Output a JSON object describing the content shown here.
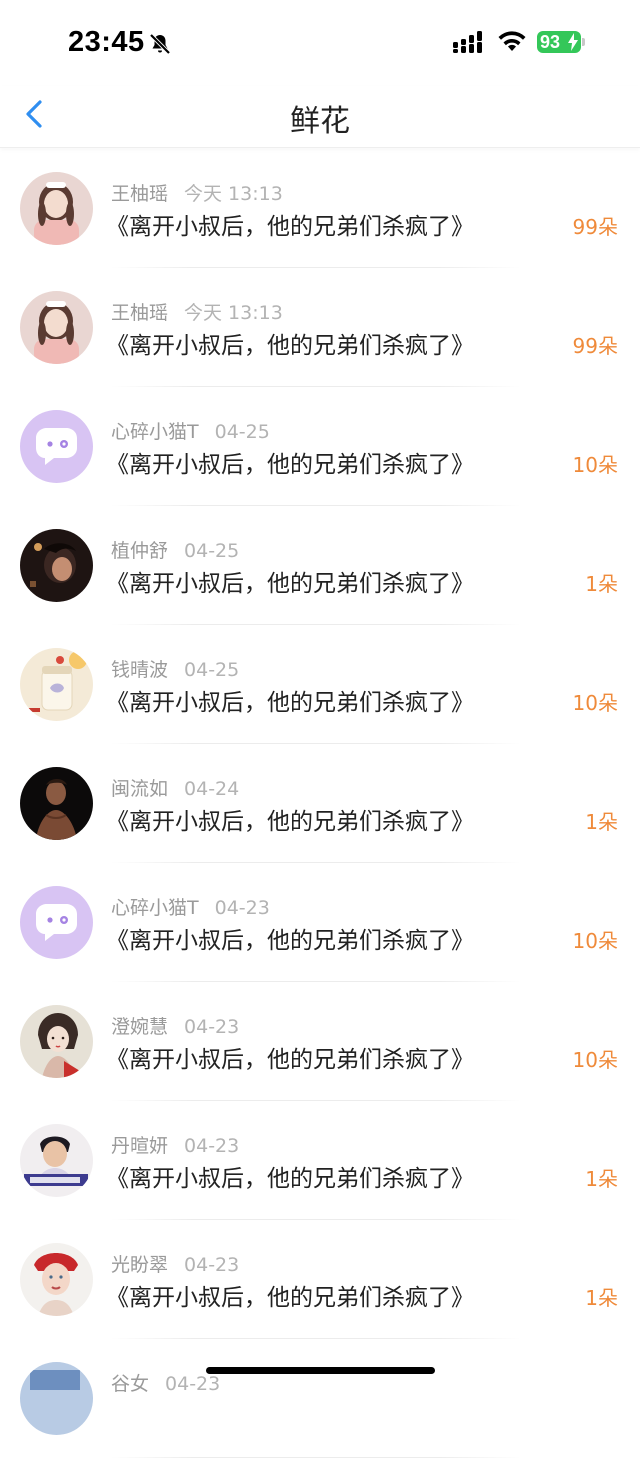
{
  "status_bar": {
    "time": "23:45",
    "battery": "93"
  },
  "nav": {
    "title": "鲜花"
  },
  "items": [
    {
      "name": "王柚瑶",
      "date": "今天 13:13",
      "book": "《离开小叔后，他的兄弟们杀疯了》",
      "count": "99朵",
      "avatar": "girl-pink"
    },
    {
      "name": "王柚瑶",
      "date": "今天 13:13",
      "book": "《离开小叔后，他的兄弟们杀疯了》",
      "count": "99朵",
      "avatar": "girl-pink"
    },
    {
      "name": "心碎小猫T",
      "date": "04-25",
      "book": "《离开小叔后，他的兄弟们杀疯了》",
      "count": "10朵",
      "avatar": "chat-bubble"
    },
    {
      "name": "植仲舒",
      "date": "04-25",
      "book": "《离开小叔后，他的兄弟们杀疯了》",
      "count": "1朵",
      "avatar": "dark-anime"
    },
    {
      "name": "钱晴波",
      "date": "04-25",
      "book": "《离开小叔后，他的兄弟们杀疯了》",
      "count": "10朵",
      "avatar": "milk-drink"
    },
    {
      "name": "闽流如",
      "date": "04-24",
      "book": "《离开小叔后，他的兄弟们杀疯了》",
      "count": "1朵",
      "avatar": "dark-man"
    },
    {
      "name": "心碎小猫T",
      "date": "04-23",
      "book": "《离开小叔后，他的兄弟们杀疯了》",
      "count": "10朵",
      "avatar": "chat-bubble"
    },
    {
      "name": "澄婉慧",
      "date": "04-23",
      "book": "《离开小叔后，他的兄弟们杀疯了》",
      "count": "10朵",
      "avatar": "painting-lady"
    },
    {
      "name": "丹暄妍",
      "date": "04-23",
      "book": "《离开小叔后，他的兄弟们杀疯了》",
      "count": "1朵",
      "avatar": "boy-banner"
    },
    {
      "name": "光盼翠",
      "date": "04-23",
      "book": "《离开小叔后，他的兄弟们杀疯了》",
      "count": "1朵",
      "avatar": "woman-red-hat"
    },
    {
      "name": "谷女",
      "date": "04-23",
      "book": "",
      "count": "",
      "avatar": "blue-partial"
    }
  ],
  "colors": {
    "accent": "#2f8ef0",
    "count": "#ef8a3a",
    "battery": "#34c759"
  }
}
